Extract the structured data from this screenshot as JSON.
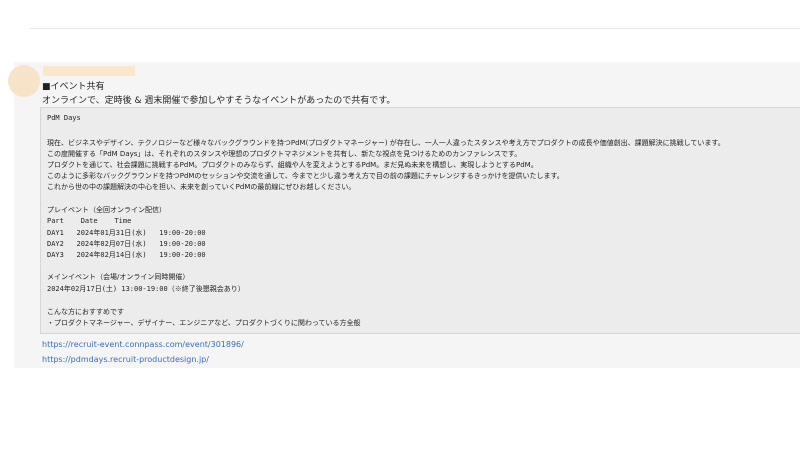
{
  "post": {
    "heading": "■イベント共有",
    "intro": "オンラインで、定時後 & 週末開催で参加しやすそうなイベントがあったので共有です。",
    "code_block": {
      "title": "PdM Days",
      "paragraph": [
        "現在、ビジネスやデザイン、テクノロジーなど様々なバックグラウンドを持つPdM(プロダクトマネージャー) が存在し、一人一人違ったスタンスや考え方でプロダクトの成長や価値創出、課題解決に挑戦しています。",
        "この度開催する「PdM Days」は、それぞれのスタンスや理想のプロダクトマネジメントを共有し、新たな視点を見つけるためのカンファレンスです。",
        "プロダクトを通じて、社会課題に挑戦するPdM。プロダクトのみならず、組織や人を変えようとするPdM。まだ見ぬ未来を構想し、実現しようとするPdM。",
        "このように多彩なバックグラウンドを持つPdMのセッションや交流を通して、今までと少し違う考え方で目の前の課題にチャレンジするきっかけを提供いたします。",
        "これから世の中の課題解決の中心を担い、未来を創っていくPdMの最前線にぜひお越しください。"
      ],
      "pre_event_title": "プレイベント（全回オンライン配信）",
      "schedule_header": "Part    Date    Time",
      "schedule": [
        "DAY1   2024年01月31日(水)   19:00-20:00",
        "DAY2   2024年02月07日(水)   19:00-20:00",
        "DAY3   2024年02月14日(水)   19:00-20:00"
      ],
      "main_event_title": "メインイベント（会場/オンライン同時開催）",
      "main_event_date": "2024年02月17日(土) 13:00-19:00（※終了後懇親会あり）",
      "recommend_title": "こんな方におすすめです",
      "recommend_item": "・プロダクトマネージャー、デザイナー、エンジニアなど、プロダクトづくりに関わっている方全般"
    },
    "links": [
      "https://recruit-event.connpass.com/event/301896/",
      "https://pdmdays.recruit-productdesign.jp/"
    ]
  },
  "colors": {
    "avatar": "#f7e3c8",
    "link": "#3b6cb8",
    "post_background": "#f5f5f5",
    "code_background": "#ececec"
  },
  "icons": {
    "avatar": "user-avatar"
  }
}
